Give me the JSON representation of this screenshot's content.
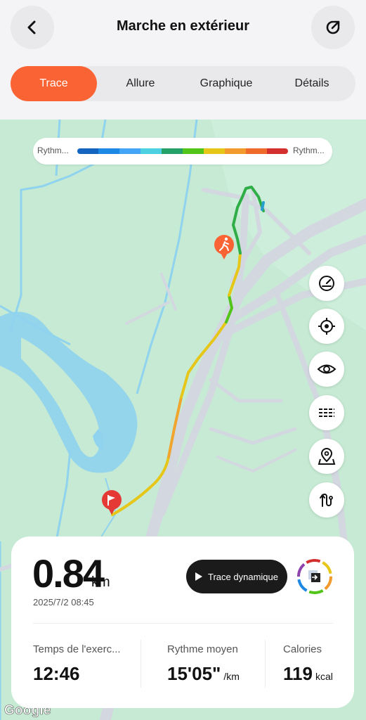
{
  "header": {
    "title": "Marche en extérieur"
  },
  "tabs": [
    {
      "label": "Trace",
      "active": true
    },
    {
      "label": "Allure",
      "active": false
    },
    {
      "label": "Graphique",
      "active": false
    },
    {
      "label": "Détails",
      "active": false
    }
  ],
  "legend": {
    "left_label": "Rythm...",
    "right_label": "Rythm...",
    "colors": [
      "#1565c0",
      "#1e88e5",
      "#42a5f5",
      "#4dd0e1",
      "#26a269",
      "#52c41a",
      "#e6c619",
      "#f29a2e",
      "#ee6b2b",
      "#d32f2f"
    ]
  },
  "map": {
    "attribution": "Google",
    "side_buttons": [
      "speedometer-icon",
      "locate-icon",
      "eye-icon",
      "layers-icon",
      "map-pin-icon",
      "route-icon"
    ]
  },
  "stats": {
    "distance": "0.84",
    "distance_unit": "km",
    "date": "2025/7/2 08:45",
    "dynamic_trace_label": "Trace dynamique",
    "duration_label": "Temps de l'exerc...",
    "duration_value": "12:46",
    "pace_label": "Rythme moyen",
    "pace_value": "15'05\"",
    "pace_unit": "/km",
    "calories_label": "Calories",
    "calories_value": "119",
    "calories_unit": "kcal"
  },
  "colors": {
    "accent": "#fa6434",
    "map_green": "#c6ead3",
    "water": "#8fd3ee",
    "road": "#d7dbe2"
  }
}
